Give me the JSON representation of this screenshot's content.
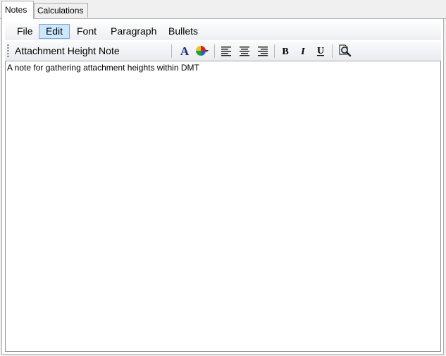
{
  "tabs": [
    {
      "label": "Notes",
      "active": true
    },
    {
      "label": "Calculations",
      "active": false
    }
  ],
  "menu": {
    "file": "File",
    "edit": "Edit",
    "font": "Font",
    "paragraph": "Paragraph",
    "bullets": "Bullets",
    "selected": "Edit"
  },
  "toolbar": {
    "note_title": "Attachment Height Note",
    "icons": [
      "font-icon",
      "color-icon",
      "align-left-icon",
      "align-center-icon",
      "align-right-icon",
      "bold-icon",
      "italic-icon",
      "underline-icon",
      "find-icon"
    ],
    "bold_glyph": "B",
    "italic_glyph": "I",
    "underline_glyph": "U",
    "font_glyph": "A"
  },
  "editor": {
    "content": "A note for gathering attachment heights within DMT"
  },
  "colors": {
    "menu_selected_bg": "#cce8ff",
    "menu_selected_border": "#7aa7d4",
    "font_icon": "#1f2d7a"
  }
}
